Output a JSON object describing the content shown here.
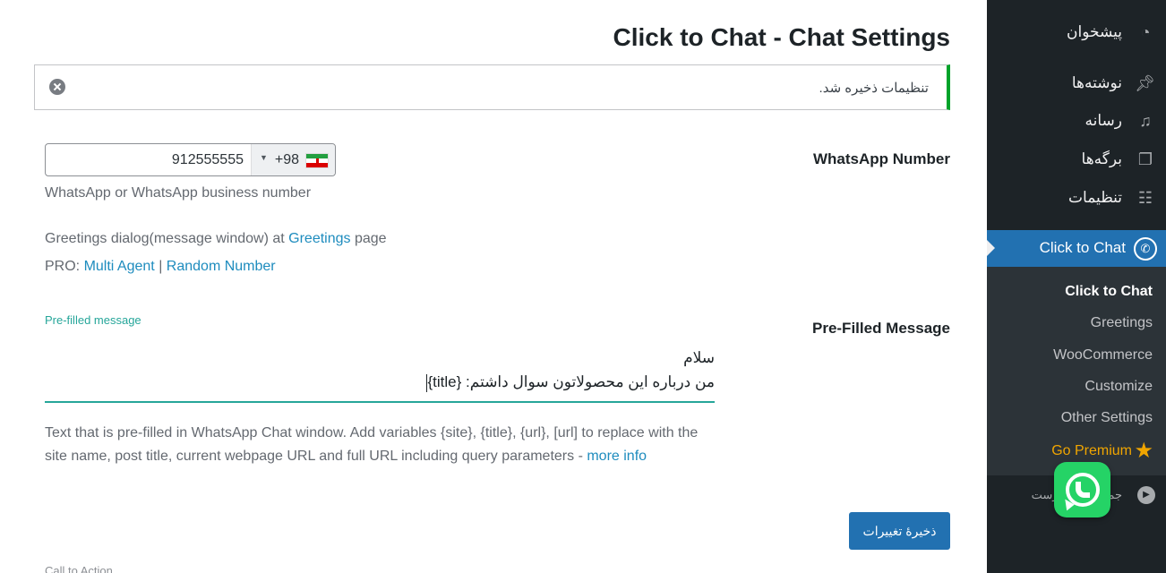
{
  "page": {
    "title": "Click to Chat - Chat Settings"
  },
  "notice": {
    "text": "تنظیمات ذخیره شد."
  },
  "whatsapp": {
    "label": "WhatsApp Number",
    "country_code": "+98",
    "number": "912555555",
    "description": "WhatsApp or WhatsApp business number"
  },
  "greetings_line": {
    "prefix": "Greetings dialog(message window) at",
    "link": "Greetings",
    "suffix": "page"
  },
  "pro_line": {
    "prefix": "PRO:",
    "link1": "Multi Agent",
    "separator": "|",
    "link2": "Random Number"
  },
  "prefilled": {
    "section_label": "Pre-Filled Message",
    "field_label": "Pre-filled message",
    "line1": "سلام",
    "line2": "من درباره این محصولاتون سوال داشتم: {title}",
    "description": "Text that is pre-filled in WhatsApp Chat window. Add variables {site}, {title}, {url}, [url] to replace with the site name, post title, current webpage URL and full URL including query parameters -",
    "more_info": "more info"
  },
  "save_button": "ذخیرهٔ تغییرات",
  "next_section_label": "Call to Action",
  "sidebar": {
    "items": [
      {
        "label": "پیشخوان",
        "icon": "dashboard-icon"
      },
      {
        "label": "نوشته‌ها",
        "icon": "pin-icon"
      },
      {
        "label": "رسانه",
        "icon": "media-icon"
      },
      {
        "label": "برگه‌ها",
        "icon": "pages-icon"
      },
      {
        "label": "تنظیمات",
        "icon": "settings-icon"
      },
      {
        "label": "Click to Chat",
        "icon": "whatsapp-icon"
      }
    ],
    "submenu": [
      {
        "label": "Click to Chat"
      },
      {
        "label": "Greetings"
      },
      {
        "label": "WooCommerce"
      },
      {
        "label": "Customize"
      },
      {
        "label": "Other Settings"
      },
      {
        "label": "Go Premium"
      }
    ],
    "collapse_label": "جمع کردن فهرست"
  },
  "colors": {
    "accent": "#2271b1",
    "success": "#00a32a",
    "teal": "#26a69a",
    "premium": "#f0a500",
    "whatsapp": "#25d366"
  }
}
